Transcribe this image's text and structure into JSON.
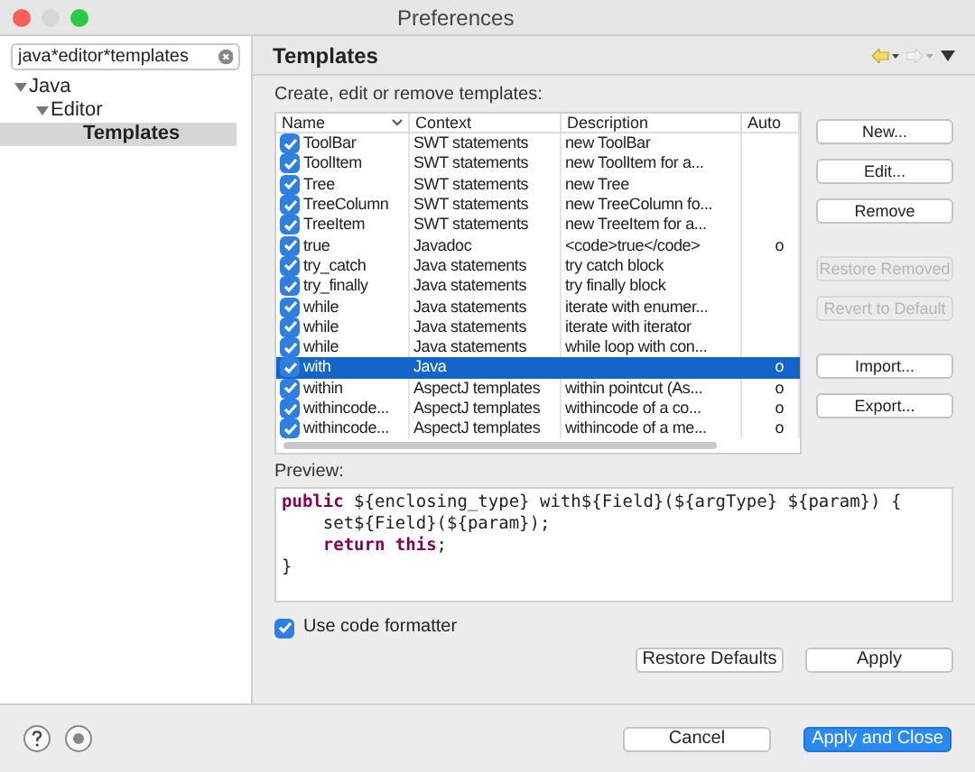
{
  "window": {
    "title": "Preferences"
  },
  "sidebar": {
    "filter": {
      "value": "java*editor*templates"
    },
    "tree": [
      {
        "label": "Java",
        "expanded": true,
        "selected": false,
        "children": [
          {
            "label": "Editor",
            "expanded": true,
            "selected": false,
            "children": [
              {
                "label": "Templates",
                "selected": true
              }
            ]
          }
        ]
      }
    ]
  },
  "page": {
    "title": "Templates",
    "description": "Create, edit or remove templates:",
    "table": {
      "columns": [
        "Name",
        "Context",
        "Description",
        "Auto"
      ],
      "rows": [
        {
          "checked": true,
          "selected": false,
          "cells": [
            "ToolBar",
            "SWT statements",
            "new ToolBar",
            ""
          ]
        },
        {
          "checked": true,
          "selected": false,
          "cells": [
            "ToolItem",
            "SWT statements",
            "new ToolItem for a...",
            ""
          ]
        },
        {
          "checked": true,
          "selected": false,
          "cells": [
            "Tree",
            "SWT statements",
            "new Tree",
            ""
          ]
        },
        {
          "checked": true,
          "selected": false,
          "cells": [
            "TreeColumn",
            "SWT statements",
            "new TreeColumn fo...",
            ""
          ]
        },
        {
          "checked": true,
          "selected": false,
          "cells": [
            "TreeItem",
            "SWT statements",
            "new TreeItem for a...",
            ""
          ]
        },
        {
          "checked": true,
          "selected": false,
          "cells": [
            "true",
            "Javadoc",
            "<code>true</code>",
            "o"
          ]
        },
        {
          "checked": true,
          "selected": false,
          "cells": [
            "try_catch",
            "Java statements",
            "try catch block",
            ""
          ]
        },
        {
          "checked": true,
          "selected": false,
          "cells": [
            "try_finally",
            "Java statements",
            "try finally block",
            ""
          ]
        },
        {
          "checked": true,
          "selected": false,
          "cells": [
            "while",
            "Java statements",
            "iterate with enumer...",
            ""
          ]
        },
        {
          "checked": true,
          "selected": false,
          "cells": [
            "while",
            "Java statements",
            "iterate with iterator",
            ""
          ]
        },
        {
          "checked": true,
          "selected": false,
          "cells": [
            "while",
            "Java statements",
            "while loop with con...",
            ""
          ]
        },
        {
          "checked": true,
          "selected": true,
          "cells": [
            "with",
            "Java",
            "",
            "o"
          ]
        },
        {
          "checked": true,
          "selected": false,
          "cells": [
            "within",
            "AspectJ templates",
            "within pointcut (As...",
            "o"
          ]
        },
        {
          "checked": true,
          "selected": false,
          "cells": [
            "withincode...",
            "AspectJ templates",
            "withincode of a co...",
            "o"
          ]
        },
        {
          "checked": true,
          "selected": false,
          "cells": [
            "withincode...",
            "AspectJ templates",
            "withincode of a me...",
            "o"
          ]
        }
      ]
    },
    "buttons": [
      {
        "label": "New...",
        "disabled": false
      },
      {
        "label": "Edit...",
        "disabled": false
      },
      {
        "label": "Remove",
        "disabled": false
      },
      {
        "label": "Restore Removed",
        "disabled": true
      },
      {
        "label": "Revert to Default",
        "disabled": true
      },
      {
        "label": "Import...",
        "disabled": false
      },
      {
        "label": "Export...",
        "disabled": false
      }
    ],
    "preview": {
      "label": "Preview:",
      "lines": [
        [
          {
            "kind": "keyword",
            "text": "public"
          },
          {
            "kind": "plain",
            "text": " ${enclosing_type} with${Field}(${argType} ${param}) {"
          }
        ],
        [
          {
            "kind": "plain",
            "text": "    set${Field}(${param});"
          }
        ],
        [
          {
            "kind": "keyword",
            "text": "    return this"
          },
          {
            "kind": "plain",
            "text": ";"
          }
        ],
        [
          {
            "kind": "plain",
            "text": "}"
          }
        ]
      ]
    },
    "use_code_formatter": {
      "label": "Use code formatter",
      "checked": true
    },
    "page_buttons": [
      "Restore Defaults",
      "Apply"
    ]
  },
  "footer": {
    "buttons": [
      {
        "label": "Cancel",
        "kind": "normal"
      },
      {
        "label": "Apply and Close",
        "kind": "default"
      }
    ]
  }
}
